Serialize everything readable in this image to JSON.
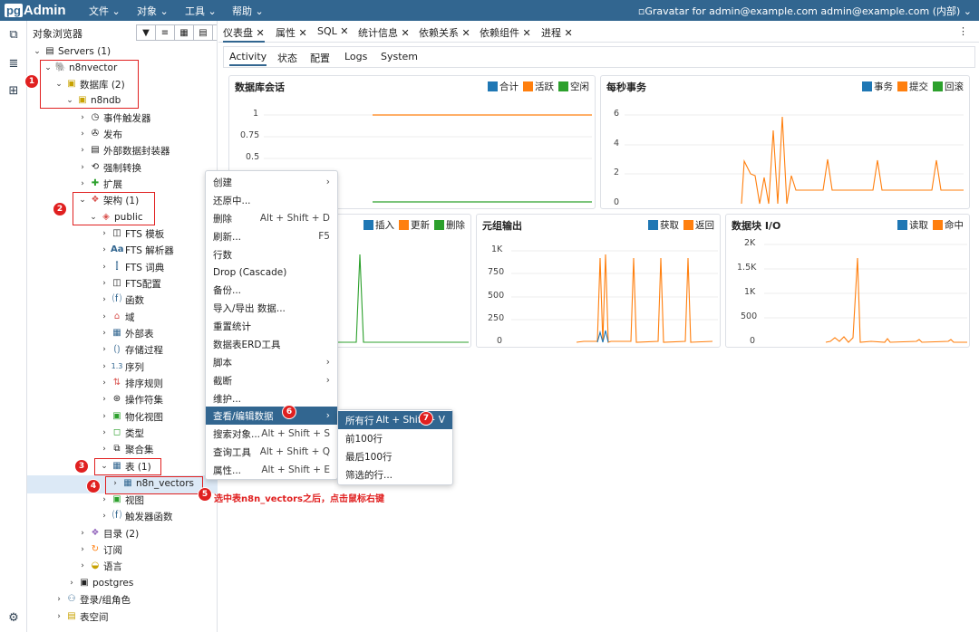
{
  "app": {
    "logo_pg": "pg",
    "logo_text": "Admin"
  },
  "menu": [
    {
      "label": "文件"
    },
    {
      "label": "对象"
    },
    {
      "label": "工具"
    },
    {
      "label": "帮助"
    }
  ],
  "user": {
    "text": "Gravatar for admin@example.com admin@example.com (内部)"
  },
  "browser": {
    "title": "对象浏览器"
  },
  "tree": [
    {
      "label": "Servers (1)"
    },
    {
      "label": "n8nvector"
    },
    {
      "label": "数据库 (2)"
    },
    {
      "label": "n8ndb"
    },
    {
      "label": "事件触发器"
    },
    {
      "label": "发布"
    },
    {
      "label": "外部数据封装器"
    },
    {
      "label": "强制转换"
    },
    {
      "label": "扩展"
    },
    {
      "label": "架构 (1)"
    },
    {
      "label": "public"
    },
    {
      "label": "FTS 模板"
    },
    {
      "label": "FTS 解析器"
    },
    {
      "label": "FTS 词典"
    },
    {
      "label": "FTS配置"
    },
    {
      "label": "函数"
    },
    {
      "label": "域"
    },
    {
      "label": "外部表"
    },
    {
      "label": "存储过程"
    },
    {
      "label": "序列"
    },
    {
      "label": "排序规则"
    },
    {
      "label": "操作符集"
    },
    {
      "label": "物化视图"
    },
    {
      "label": "类型"
    },
    {
      "label": "聚合集"
    },
    {
      "label": "表 (1)"
    },
    {
      "label": "n8n_vectors"
    },
    {
      "label": "视图"
    },
    {
      "label": "触发器函数"
    },
    {
      "label": "目录 (2)"
    },
    {
      "label": "订阅"
    },
    {
      "label": "语言"
    },
    {
      "label": "postgres"
    },
    {
      "label": "登录/组角色"
    },
    {
      "label": "表空间"
    }
  ],
  "tabs": [
    {
      "label": "仪表盘"
    },
    {
      "label": "属性"
    },
    {
      "label": "SQL"
    },
    {
      "label": "统计信息"
    },
    {
      "label": "依赖关系"
    },
    {
      "label": "依赖组件"
    },
    {
      "label": "进程"
    }
  ],
  "subtabs": [
    {
      "label": "Activity"
    },
    {
      "label": "状态"
    },
    {
      "label": "配置"
    },
    {
      "label": "Logs"
    },
    {
      "label": "System"
    }
  ],
  "colors": {
    "blue": "#1f77b4",
    "orange": "#ff7f0e",
    "green": "#2ca02c",
    "accent": "#326690",
    "annotation": "#e02020"
  },
  "panels": {
    "sessions": {
      "title": "数据库会话",
      "legend": [
        "合计",
        "活跃",
        "空闲"
      ],
      "yticks": [
        "1",
        "0.75",
        "0.5"
      ]
    },
    "tps": {
      "title": "每秒事务",
      "legend": [
        "事务",
        "提交",
        "回滚"
      ],
      "yticks": [
        "6",
        "4",
        "2",
        "0"
      ]
    },
    "tuples_in": {
      "legend": [
        "插入",
        "更新",
        "删除"
      ]
    },
    "tuples_out": {
      "title": "元组输出",
      "legend": [
        "获取",
        "返回"
      ],
      "yticks": [
        "1K",
        "750",
        "500",
        "250",
        "0"
      ]
    },
    "blockio": {
      "title": "数据块 I/O",
      "legend": [
        "读取",
        "命中"
      ],
      "yticks": [
        "2K",
        "1.5K",
        "1K",
        "500",
        "0"
      ]
    }
  },
  "context_menu": [
    {
      "label": "创建",
      "shortcut": "",
      "arrow": "›"
    },
    {
      "label": "还原中...",
      "shortcut": ""
    },
    {
      "label": "删除",
      "shortcut": "Alt + Shift + D"
    },
    {
      "label": "刷新...",
      "shortcut": "F5"
    },
    {
      "label": "行数",
      "shortcut": ""
    },
    {
      "label": "Drop (Cascade)",
      "shortcut": ""
    },
    {
      "label": "备份...",
      "shortcut": ""
    },
    {
      "label": "导入/导出 数据...",
      "shortcut": ""
    },
    {
      "label": "重置统计",
      "shortcut": ""
    },
    {
      "label": "数据表ERD工具",
      "shortcut": ""
    },
    {
      "label": "脚本",
      "shortcut": "",
      "arrow": "›"
    },
    {
      "label": "截断",
      "shortcut": "",
      "arrow": "›"
    },
    {
      "label": "维护...",
      "shortcut": ""
    },
    {
      "label": "查看/编辑数据",
      "shortcut": "",
      "arrow": "›"
    },
    {
      "label": "搜索对象...",
      "shortcut": "Alt + Shift + S"
    },
    {
      "label": "查询工具",
      "shortcut": "Alt + Shift + Q"
    },
    {
      "label": "属性...",
      "shortcut": "Alt + Shift + E"
    }
  ],
  "submenu": [
    {
      "label": "所有行",
      "shortcut": "Alt + Shift + V"
    },
    {
      "label": "前100行",
      "shortcut": ""
    },
    {
      "label": "最后100行",
      "shortcut": ""
    },
    {
      "label": "筛选的行...",
      "shortcut": ""
    }
  ],
  "annotations": {
    "badges": [
      "1",
      "2",
      "3",
      "4",
      "5",
      "6",
      "7"
    ],
    "note": "选中表n8n_vectors之后，点击鼠标右键"
  }
}
